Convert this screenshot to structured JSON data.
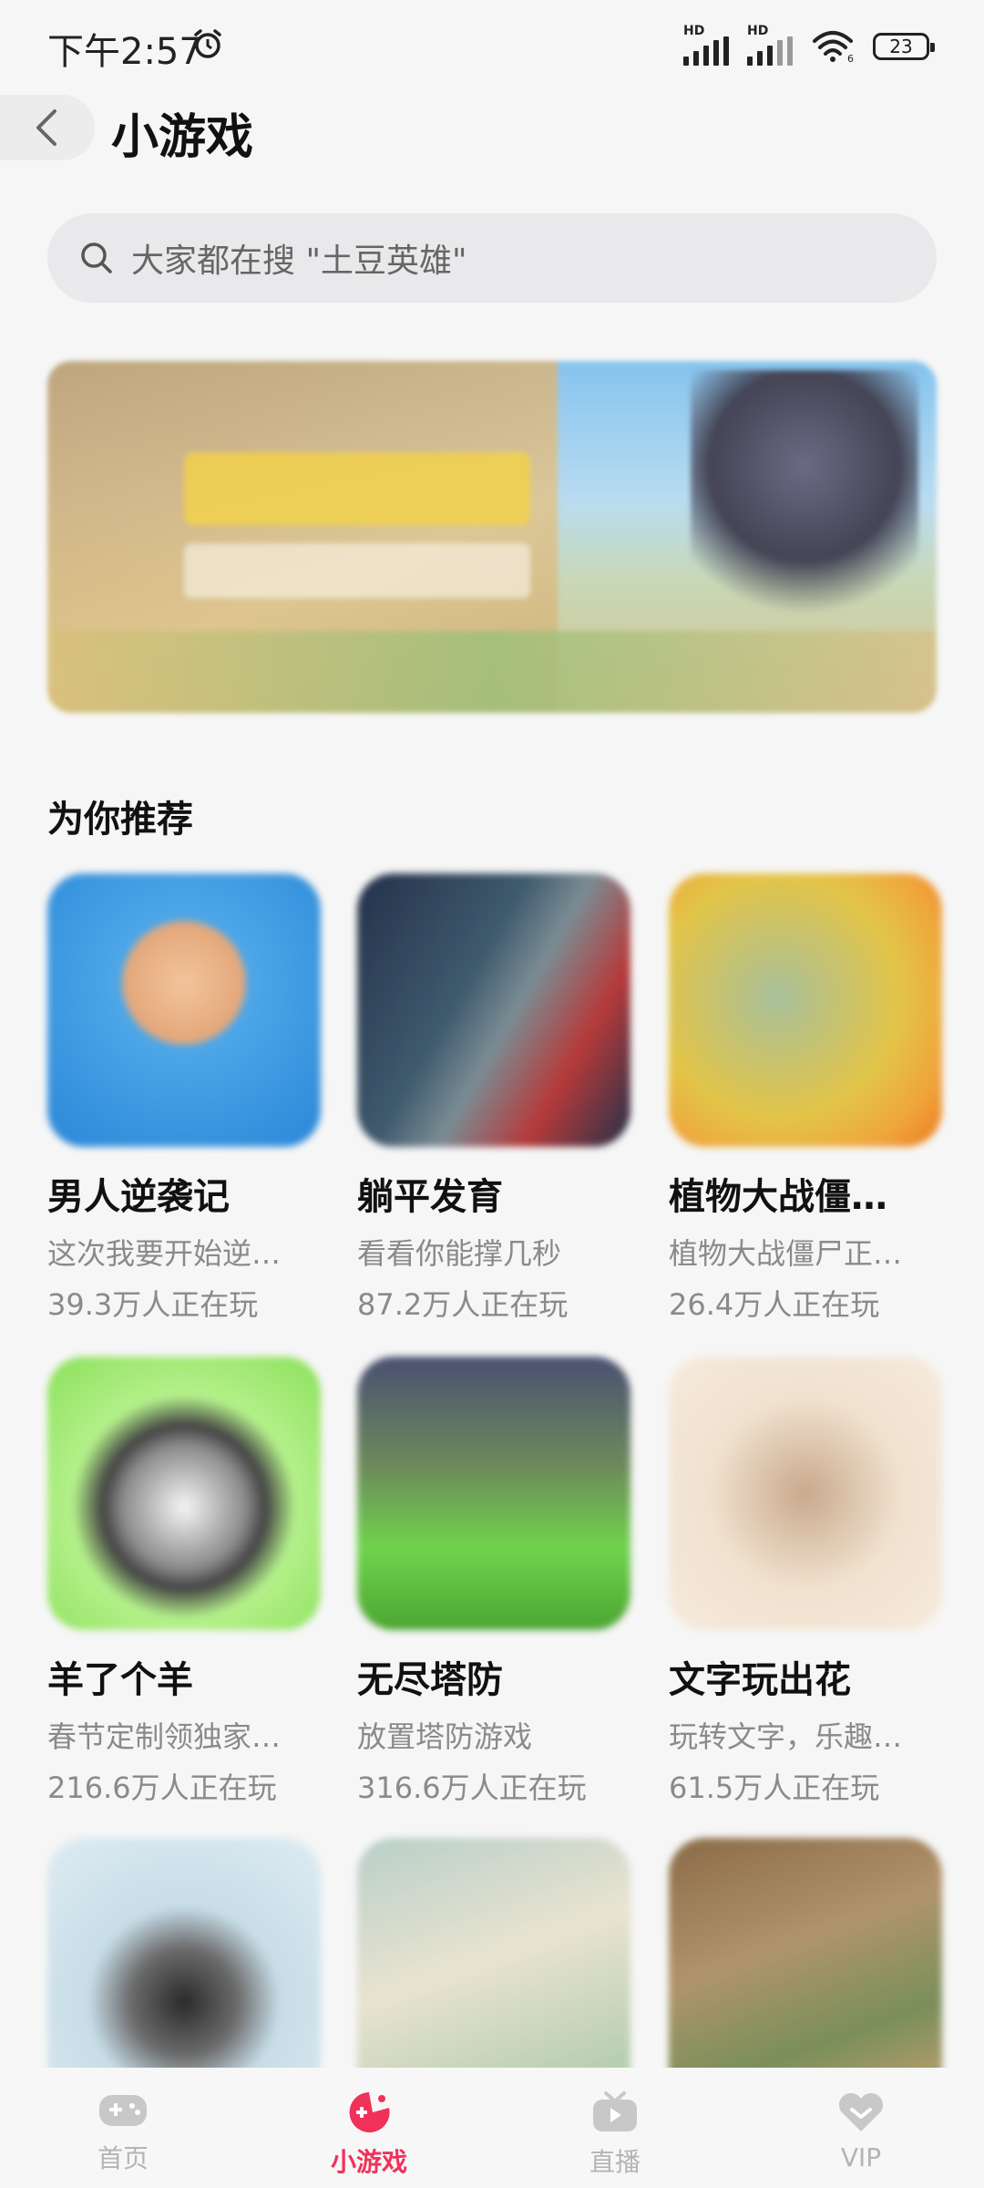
{
  "status_bar": {
    "time": "下午2:57",
    "battery": "23",
    "signal1_label": "HD",
    "signal2_label": "HD",
    "wifi_label": "6"
  },
  "header": {
    "title": "小游戏"
  },
  "search": {
    "placeholder": "大家都在搜 \"土豆英雄\""
  },
  "section": {
    "title": "为你推荐"
  },
  "games": [
    {
      "name": "男人逆袭记",
      "desc": "这次我要开始逆…",
      "players": "39.3万人正在玩"
    },
    {
      "name": "躺平发育",
      "desc": "看看你能撑几秒",
      "players": "87.2万人正在玩"
    },
    {
      "name": "植物大战僵…",
      "desc": "植物大战僵尸正…",
      "players": "26.4万人正在玩"
    },
    {
      "name": "羊了个羊",
      "desc": "春节定制领独家…",
      "players": "216.6万人正在玩"
    },
    {
      "name": "无尽塔防",
      "desc": "放置塔防游戏",
      "players": "316.6万人正在玩"
    },
    {
      "name": "文字玩出花",
      "desc": "玩转文字，乐趣…",
      "players": "61.5万人正在玩"
    }
  ],
  "nav": {
    "home": "首页",
    "games": "小游戏",
    "live": "直播",
    "vip": "VIP"
  },
  "colors": {
    "accent": "#f0325a",
    "inactive": "#b4b4b4"
  }
}
